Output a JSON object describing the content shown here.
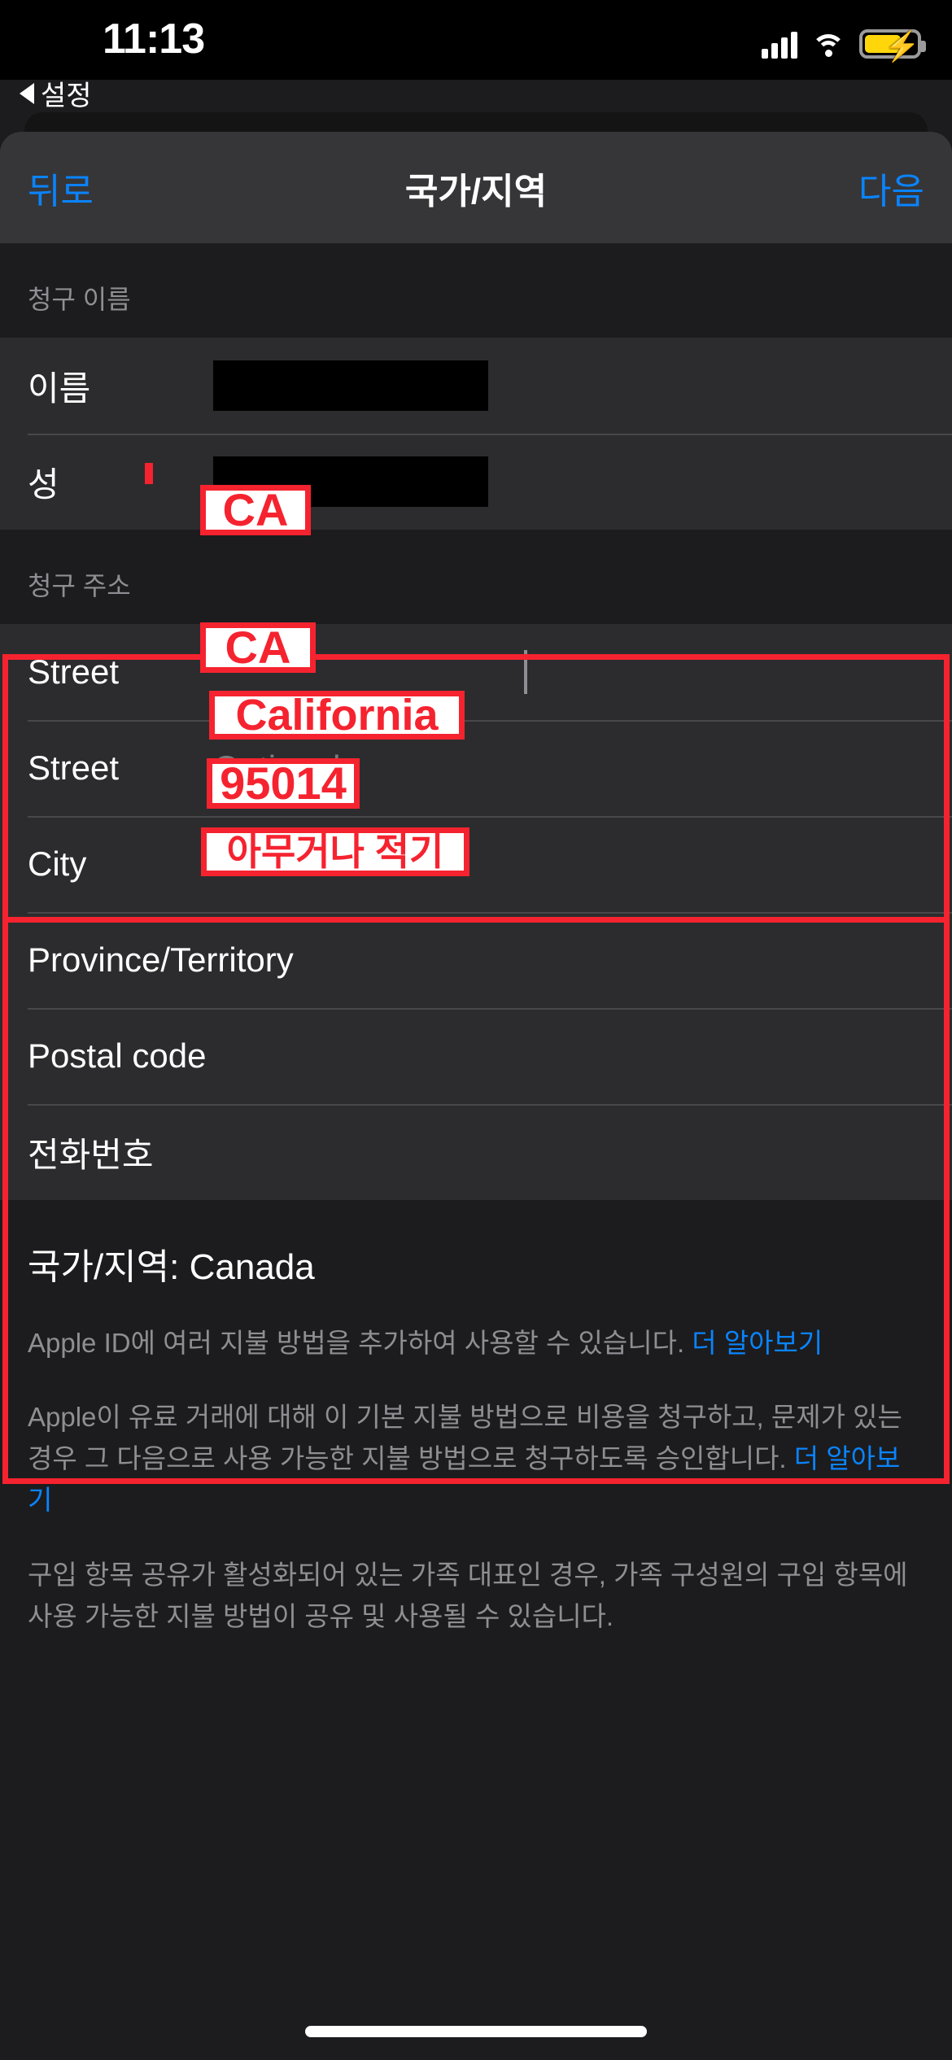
{
  "status_bar": {
    "time": "11:13",
    "signal_icon": "cellular-signal-icon",
    "wifi_icon": "wifi-icon",
    "battery_icon": "battery-charging-icon"
  },
  "breadcrumb": {
    "back_label": "설정",
    "icon": "back-triangle-icon"
  },
  "navbar": {
    "back_label": "뒤로",
    "title": "국가/지역",
    "next_label": "다음"
  },
  "billing_name": {
    "section_title": "청구 이름",
    "rows": [
      {
        "label": "이름",
        "value": "",
        "redacted": true,
        "required": false
      },
      {
        "label": "성",
        "value": "",
        "redacted": true,
        "required": true
      }
    ]
  },
  "billing_address": {
    "section_title": "청구 주소",
    "rows": [
      {
        "label": "Street",
        "placeholder": "",
        "annotation": "CA"
      },
      {
        "label": "Street",
        "placeholder": "Optional",
        "annotation": ""
      },
      {
        "label": "City",
        "placeholder": "",
        "annotation": "CA"
      },
      {
        "label": "Province/Territory",
        "placeholder": "",
        "annotation": "California"
      },
      {
        "label": "Postal code",
        "placeholder": "",
        "annotation": "95014"
      },
      {
        "label": "전화번호",
        "placeholder": "",
        "annotation": "아무거나 적기"
      }
    ]
  },
  "country_line": "국가/지역: Canada",
  "footnotes": [
    {
      "text": "Apple ID에 여러 지불 방법을 추가하여 사용할 수 있습니다. ",
      "link": "더 알아보기",
      "tail": ""
    },
    {
      "text": "Apple이 유료 거래에 대해 이 기본 지불 방법으로 비용을 청구하고, 문제가 있는 경우 그 다음으로 사용 가능한 지불 방법으로 청구하도록 승인합니다. ",
      "link": "더 알아보기",
      "tail": ""
    },
    {
      "text": "구입 항목 공유가 활성화되어 있는 가족 대표인 경우, 가족 구성원의 구입 항목에 사용 가능한 지불 방법이 공유 및 사용될 수 있습니다.",
      "link": "",
      "tail": ""
    }
  ],
  "colors": {
    "accent": "#0a84ff",
    "annotation": "#f5232f",
    "battery": "#ffd60a",
    "sheet_bg": "#1c1c1e",
    "group_bg": "#2c2c2e",
    "navbar_bg": "#363638"
  },
  "home_indicator": "home-indicator"
}
